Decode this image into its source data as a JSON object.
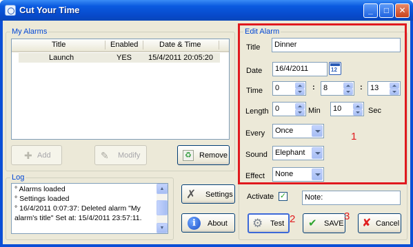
{
  "window": {
    "title": "Cut Your Time",
    "min": "_",
    "max": "□",
    "close": "✕"
  },
  "alarms": {
    "legend": "My Alarms",
    "columns": [
      "Title",
      "Enabled",
      "Date & Time"
    ],
    "rows": [
      {
        "title": "Launch",
        "enabled": "YES",
        "datetime": "15/4/2011 20:05:20"
      }
    ],
    "add_label": "Add",
    "modify_label": "Modify",
    "remove_label": "Remove"
  },
  "edit": {
    "legend": "Edit Alarm",
    "title_label": "Title",
    "title_value": "Dinner",
    "date_label": "Date",
    "date_value": "16/4/2011",
    "time_label": "Time",
    "hour": "0",
    "minute": "8",
    "second": "13",
    "sep": ":",
    "length_label": "Length",
    "length_min": "0",
    "min_unit": "Min",
    "length_sec": "10",
    "sec_unit": "Sec",
    "every_label": "Every",
    "every_value": "Once",
    "sound_label": "Sound",
    "sound_value": "Elephant",
    "effect_label": "Effect",
    "effect_value": "None"
  },
  "log": {
    "legend": "Log",
    "lines": [
      "° Alarms loaded",
      "° Settings loaded",
      "° 16/4/2011 0:07:37: Deleted alarm \"My",
      "alarm's title\" Set at: 15/4/2011 23:57:11."
    ]
  },
  "buttons": {
    "settings": "Settings",
    "about": "About",
    "test": "Test",
    "save": "SAVE",
    "cancel": "Cancel"
  },
  "activate": {
    "label": "Activate",
    "checked": "✓",
    "note_value": "Note:"
  },
  "annotations": {
    "n1": "1",
    "n2": "2",
    "n3": "3"
  },
  "colors": {
    "accent": "#0046d5",
    "highlight_box": "#e0191e"
  }
}
